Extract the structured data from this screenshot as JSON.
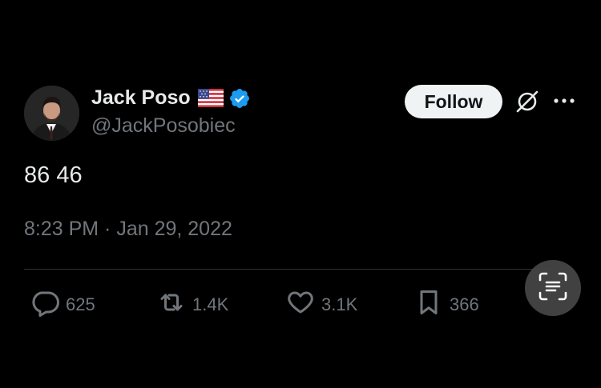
{
  "author": {
    "display_name": "Jack Poso",
    "handle": "@JackPosobiec",
    "flag_icon": "us-flag-icon",
    "verified_icon": "verified-badge-icon"
  },
  "actions_top": {
    "follow_label": "Follow",
    "grok_icon": "grok-icon",
    "more_icon": "more-dots-icon"
  },
  "tweet": {
    "text": "86 46",
    "timestamp": "8:23 PM · Jan 29, 2022"
  },
  "engagement": {
    "replies": "625",
    "reposts": "1.4K",
    "likes": "3.1K",
    "bookmarks": "366"
  },
  "colors": {
    "background": "#000000",
    "primary_text": "#e7e9ea",
    "secondary_text": "#71767b",
    "verified_blue": "#1d9bf0",
    "follow_bg": "#eff3f4"
  }
}
